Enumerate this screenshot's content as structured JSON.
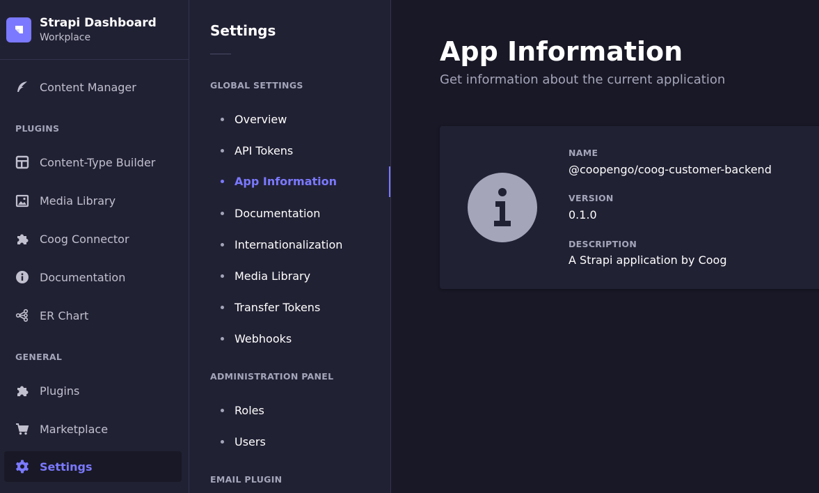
{
  "brand": {
    "title": "Strapi Dashboard",
    "subtitle": "Workplace"
  },
  "main_nav": {
    "content_manager": "Content Manager",
    "plugins_section": "PLUGINS",
    "content_type_builder": "Content-Type Builder",
    "media_library": "Media Library",
    "coog_connector": "Coog Connector",
    "documentation": "Documentation",
    "er_chart": "ER Chart",
    "general_section": "GENERAL",
    "plugins": "Plugins",
    "marketplace": "Marketplace",
    "settings": "Settings"
  },
  "settings_nav": {
    "title": "Settings",
    "global_section": "GLOBAL SETTINGS",
    "global_items": [
      "Overview",
      "API Tokens",
      "App Information",
      "Documentation",
      "Internationalization",
      "Media Library",
      "Transfer Tokens",
      "Webhooks"
    ],
    "admin_section": "ADMINISTRATION PANEL",
    "admin_items": [
      "Roles",
      "Users"
    ],
    "email_section": "EMAIL PLUGIN"
  },
  "main": {
    "title": "App Information",
    "subtitle": "Get information about the current application",
    "fields": {
      "name_label": "NAME",
      "name_value": "@coopengo/coog-customer-backend",
      "version_label": "VERSION",
      "version_value": "0.1.0",
      "description_label": "DESCRIPTION",
      "description_value": "A Strapi application by Coog"
    }
  },
  "colors": {
    "accent": "#7b79ff",
    "background": "#181826",
    "panel": "#212134",
    "muted": "#a5a5ba"
  }
}
